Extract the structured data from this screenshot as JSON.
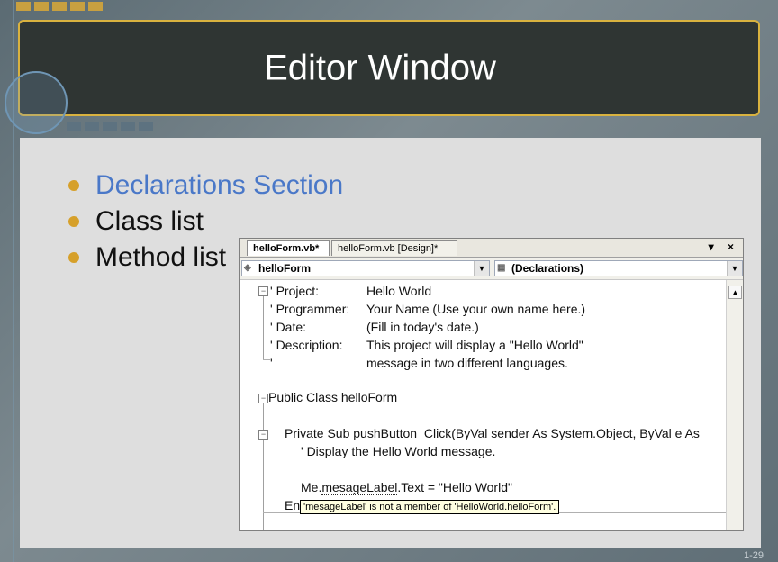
{
  "slide": {
    "title": "Editor Window",
    "bullets": [
      "Declarations Section",
      "Class list",
      "Method list"
    ],
    "slide_number": "1-29",
    "colors": {
      "accent": "#d9b23f",
      "active_bullet": "#4a78c8"
    }
  },
  "editor": {
    "tabs": [
      "helloForm.vb*",
      "helloForm.vb [Design]*"
    ],
    "window_buttons": "▾ ×",
    "class_combo": "helloForm",
    "method_combo": "(Declarations)",
    "code": {
      "l1a": "' Project:",
      "l1b": "Hello World",
      "l2a": "' Programmer:",
      "l2b": "Your Name (Use your own name here.)",
      "l3a": "' Date:",
      "l3b": "(Fill in today's date.)",
      "l4a": "' Description:",
      "l4b": "This project will display a \"Hello World\"",
      "l5a": "'",
      "l5b": "message in two different languages.",
      "l6": "Public Class helloForm",
      "l7": "Private Sub pushButton_Click(ByVal sender As System.Object, ByVal e As",
      "l8": "' Display the Hello World message.",
      "l9a": "Me.",
      "l9b": "mesageLabel",
      "l9c": ".Text = \"Hello World\"",
      "l10": "En"
    },
    "tooltip": "'mesageLabel' is not a member of 'HelloWorld.helloForm'."
  }
}
